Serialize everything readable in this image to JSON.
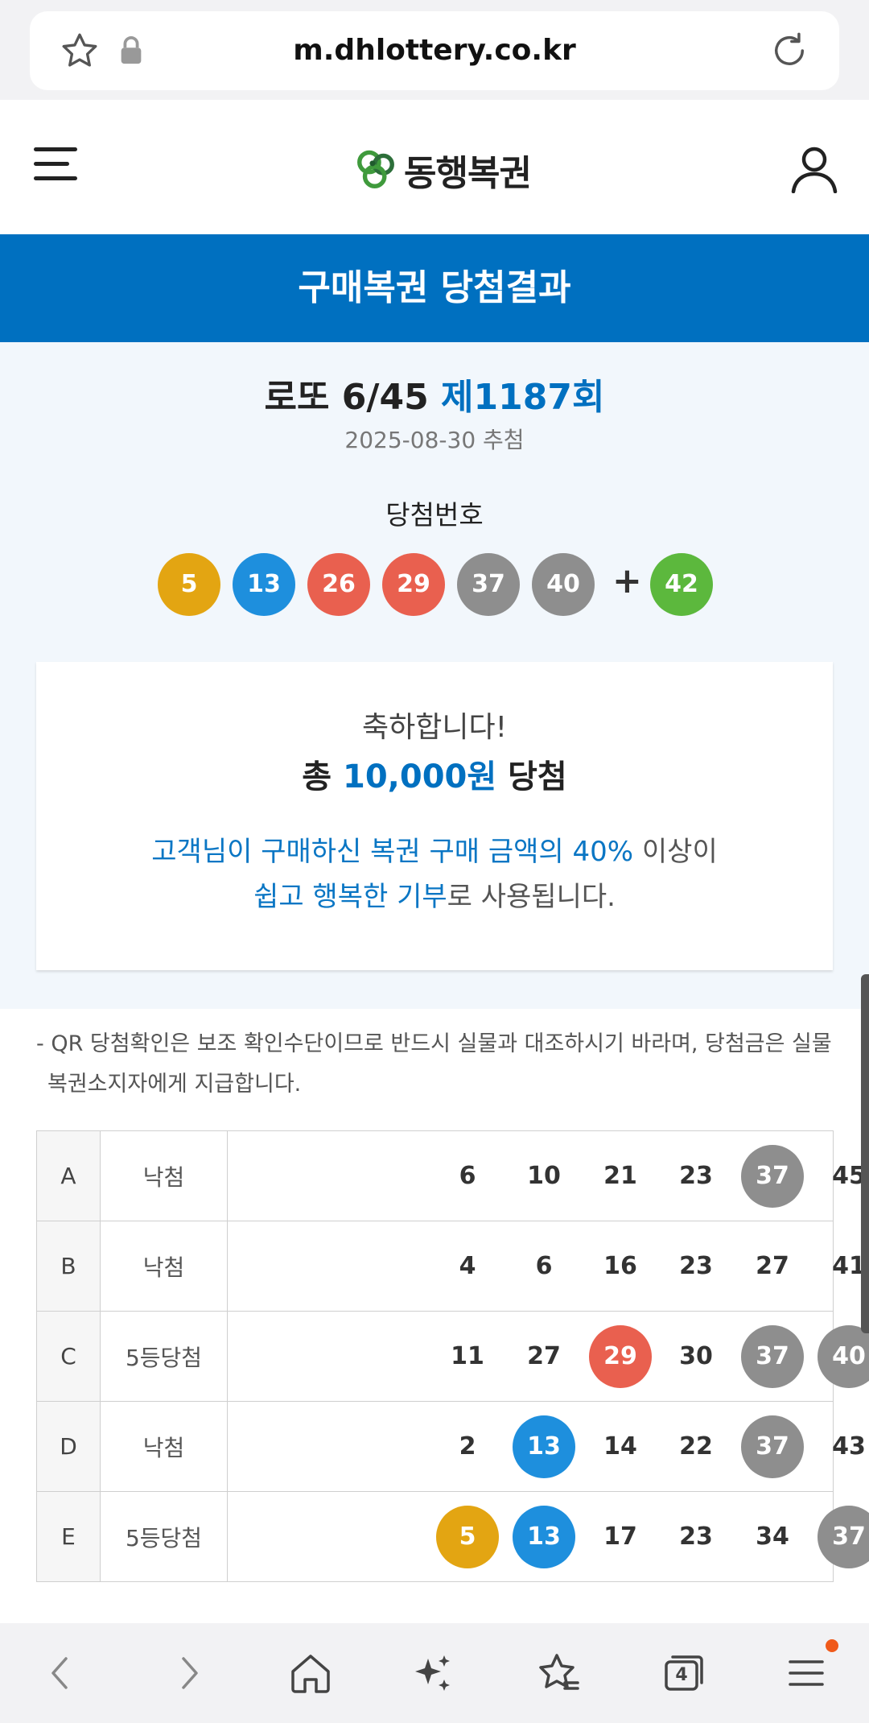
{
  "browser": {
    "url": "m.dhlottery.co.kr"
  },
  "header": {
    "brand": "동행복권"
  },
  "title_bar": {
    "title": "구매복권 당첨결과"
  },
  "result": {
    "game_name": "로또 6/45",
    "round_label": "제1187회",
    "draw_date": "2025-08-30 추첨",
    "winning_label": "당첨번호",
    "winning_numbers": [
      {
        "value": "5",
        "color": "#e3a512"
      },
      {
        "value": "13",
        "color": "#1e8fdd"
      },
      {
        "value": "26",
        "color": "#e9604f"
      },
      {
        "value": "29",
        "color": "#e9604f"
      },
      {
        "value": "37",
        "color": "#8e8e8e"
      },
      {
        "value": "40",
        "color": "#8e8e8e"
      }
    ],
    "plus": "+",
    "bonus_number": {
      "value": "42",
      "color": "#5cb83d"
    }
  },
  "card": {
    "congrats": "축하합니다!",
    "total_prefix": "총",
    "total_amount": "10,000원",
    "total_suffix": "당첨",
    "donate_line1_highlight": "고객님이 구매하신 복권 구매 금액의 40%",
    "donate_line1_rest": "이상이",
    "donate_line2_highlight": "쉽고 행복한 기부",
    "donate_line2_rest": "로 사용됩니다."
  },
  "notice": "- QR 당첨확인은 보조 확인수단이므로 반드시 실물과 대조하시기 바라며, 당첨금은 실물 복권소지자에게 지급합니다.",
  "tickets": [
    {
      "slot": "A",
      "status": "낙첨",
      "numbers": [
        {
          "value": "6",
          "hit": ""
        },
        {
          "value": "10",
          "hit": ""
        },
        {
          "value": "21",
          "hit": ""
        },
        {
          "value": "23",
          "hit": ""
        },
        {
          "value": "37",
          "hit": "#8e8e8e"
        },
        {
          "value": "45",
          "hit": ""
        }
      ]
    },
    {
      "slot": "B",
      "status": "낙첨",
      "numbers": [
        {
          "value": "4",
          "hit": ""
        },
        {
          "value": "6",
          "hit": ""
        },
        {
          "value": "16",
          "hit": ""
        },
        {
          "value": "23",
          "hit": ""
        },
        {
          "value": "27",
          "hit": ""
        },
        {
          "value": "41",
          "hit": ""
        }
      ]
    },
    {
      "slot": "C",
      "status": "5등당첨",
      "numbers": [
        {
          "value": "11",
          "hit": ""
        },
        {
          "value": "27",
          "hit": ""
        },
        {
          "value": "29",
          "hit": "#e9604f"
        },
        {
          "value": "30",
          "hit": ""
        },
        {
          "value": "37",
          "hit": "#8e8e8e"
        },
        {
          "value": "40",
          "hit": "#8e8e8e"
        }
      ]
    },
    {
      "slot": "D",
      "status": "낙첨",
      "numbers": [
        {
          "value": "2",
          "hit": ""
        },
        {
          "value": "13",
          "hit": "#1e8fdd"
        },
        {
          "value": "14",
          "hit": ""
        },
        {
          "value": "22",
          "hit": ""
        },
        {
          "value": "37",
          "hit": "#8e8e8e"
        },
        {
          "value": "43",
          "hit": ""
        }
      ]
    },
    {
      "slot": "E",
      "status": "5등당첨",
      "numbers": [
        {
          "value": "5",
          "hit": "#e3a512"
        },
        {
          "value": "13",
          "hit": "#1e8fdd"
        },
        {
          "value": "17",
          "hit": ""
        },
        {
          "value": "23",
          "hit": ""
        },
        {
          "value": "34",
          "hit": ""
        },
        {
          "value": "37",
          "hit": "#8e8e8e"
        }
      ]
    }
  ],
  "bottom_nav": {
    "tab_count": "4"
  },
  "colors": {
    "brand_blue": "#0070c0",
    "notification": "#f05a1a"
  }
}
